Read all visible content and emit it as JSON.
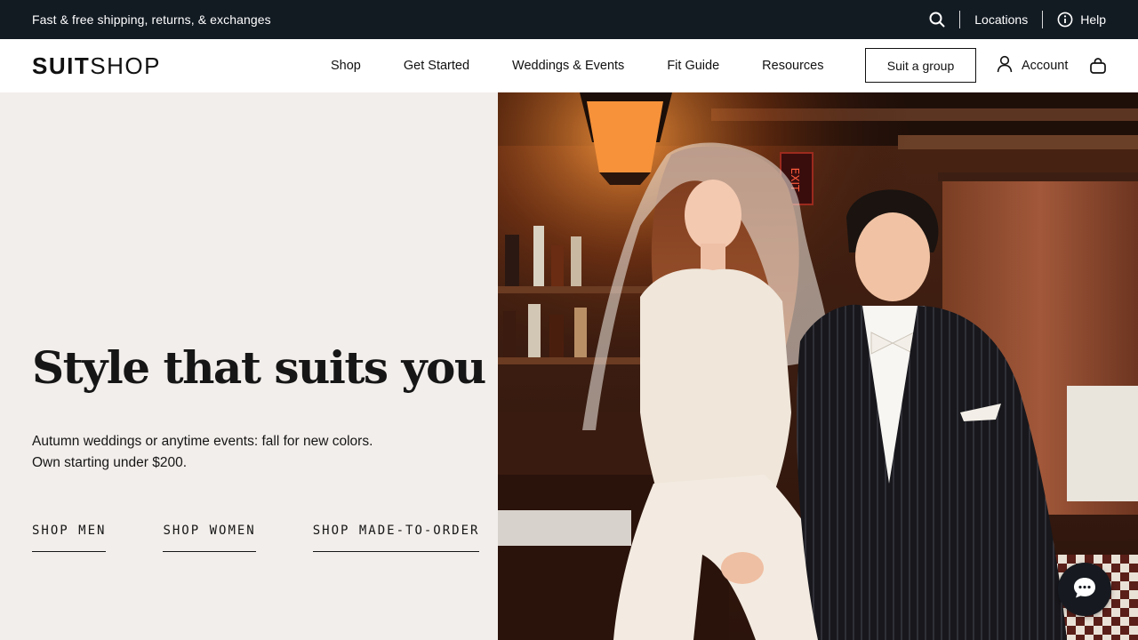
{
  "announcement": {
    "text": "Fast & free shipping, returns, & exchanges",
    "search_icon": "search-icon",
    "locations_label": "Locations",
    "help_label": "Help",
    "help_icon": "info-circle-icon"
  },
  "nav": {
    "logo_bold": "SUIT",
    "logo_light": "SHOP",
    "items": [
      "Shop",
      "Get Started",
      "Weddings & Events",
      "Fit Guide",
      "Resources"
    ],
    "group_button": "Suit a group",
    "account_label": "Account",
    "account_icon": "user-icon",
    "bag_icon": "shopping-bag-icon"
  },
  "hero": {
    "headline": "Style that suits you",
    "subcopy_line1": "Autumn weddings or anytime events: fall for new colors.",
    "subcopy_line2": "Own starting under $200.",
    "ctas": [
      "SHOP MEN",
      "SHOP WOMEN",
      "SHOP MADE-TO-ORDER"
    ],
    "sign_text": "EXIT"
  },
  "chat": {
    "icon": "chat-bubble-icon"
  },
  "colors": {
    "topbar_bg": "#121a22",
    "hero_left_bg": "#f2eeeb",
    "text_dark": "#161616"
  }
}
